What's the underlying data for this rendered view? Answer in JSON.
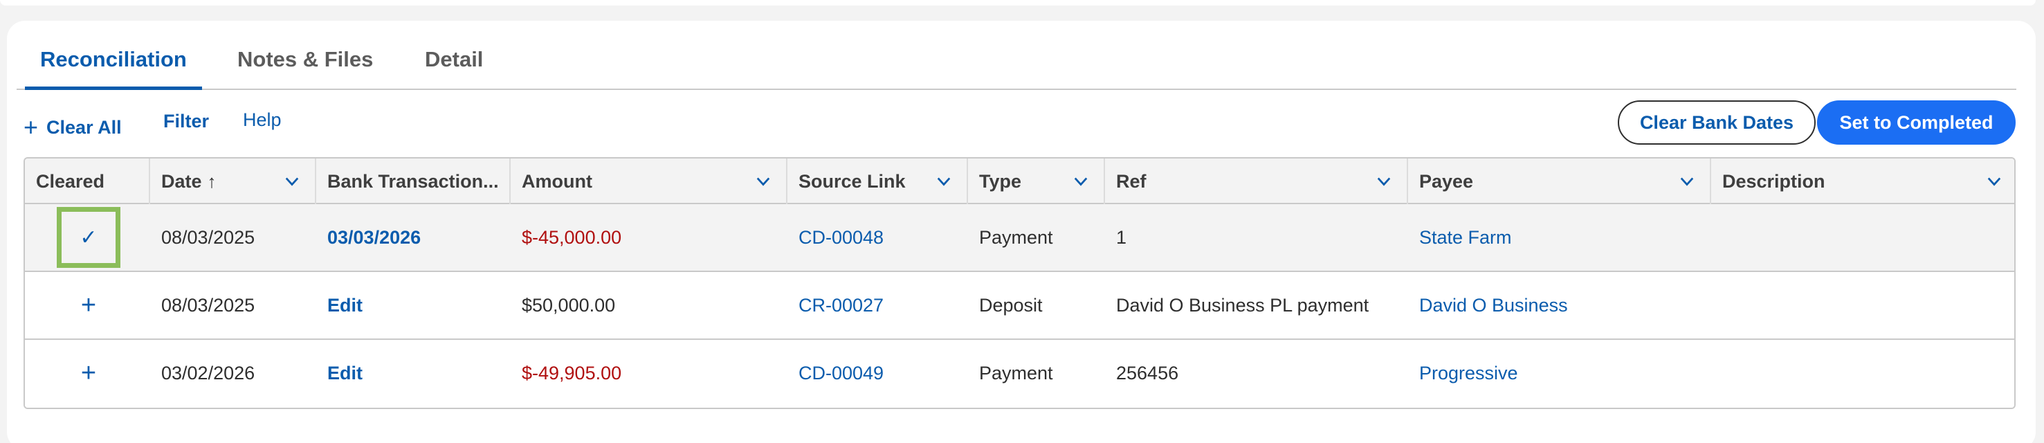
{
  "tabs": [
    {
      "label": "Reconciliation",
      "active": true
    },
    {
      "label": "Notes & Files",
      "active": false
    },
    {
      "label": "Detail",
      "active": false
    }
  ],
  "toolbar": {
    "plus_icon": "+",
    "clear_all": "Clear All",
    "filter": "Filter",
    "help": "Help",
    "clear_bank_dates": "Clear Bank Dates",
    "set_to_completed": "Set to Completed"
  },
  "table": {
    "columns": [
      "Cleared",
      "Date",
      "Bank Transaction...",
      "Amount",
      "Source Link",
      "Type",
      "Ref",
      "Payee",
      "Description"
    ],
    "sort_icon": "↑",
    "rows": [
      {
        "cleared": "✓",
        "date": "08/03/2025",
        "bank_date": "03/03/2026",
        "amount": "$-45,000.00",
        "source_link": "CD-00048",
        "type": "Payment",
        "ref": "1",
        "payee": "State Farm",
        "description": ""
      },
      {
        "cleared": "+",
        "date": "08/03/2025",
        "bank_date": "Edit",
        "amount": "$50,000.00",
        "source_link": "CR-00027",
        "type": "Deposit",
        "ref": "David O Business PL payment",
        "payee": "David O Business",
        "description": ""
      },
      {
        "cleared": "+",
        "date": "03/02/2026",
        "bank_date": "Edit",
        "amount": "$-49,905.00",
        "source_link": "CD-00049",
        "type": "Payment",
        "ref": "256456",
        "payee": "Progressive",
        "description": ""
      }
    ]
  },
  "colors": {
    "accent": "#0b5cad",
    "primary_button": "#1b6ef3",
    "negative": "#b01010",
    "highlight": "#8bbd5a"
  }
}
